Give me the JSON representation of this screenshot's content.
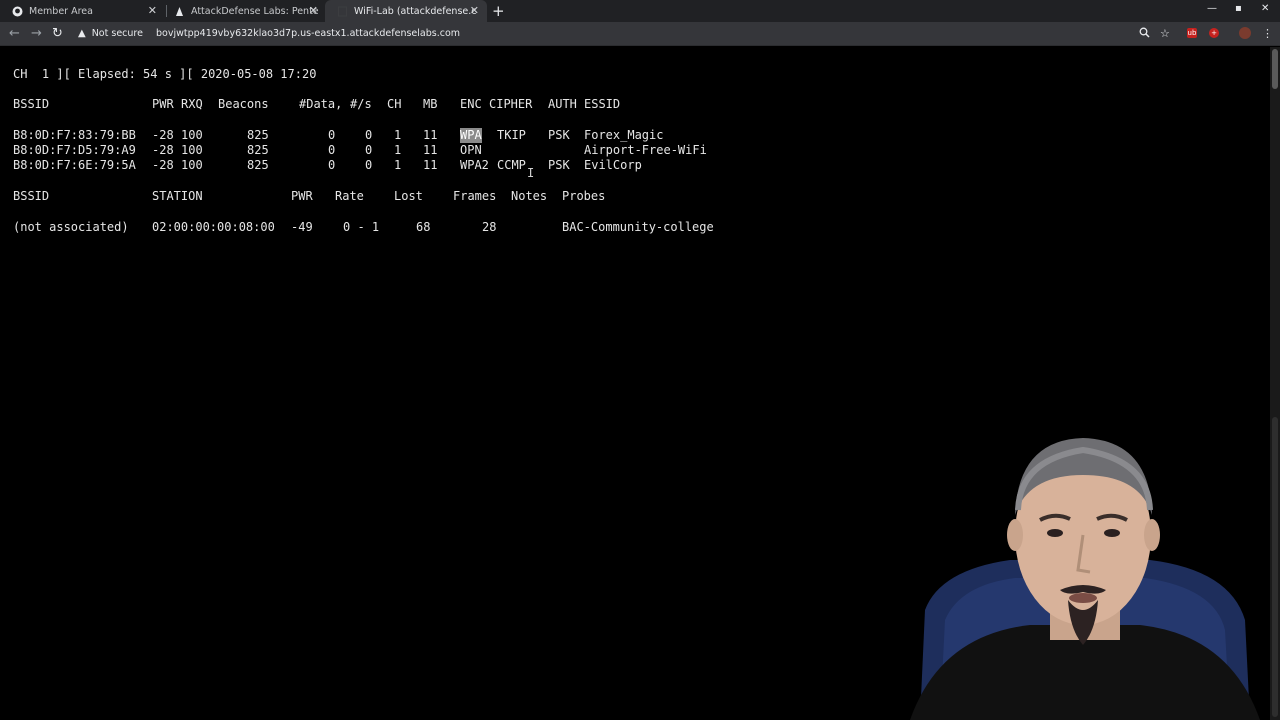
{
  "browser": {
    "tabs": [
      {
        "title": "Member Area",
        "icon": "github-icon"
      },
      {
        "title": "AttackDefense Labs: Pente",
        "icon": "attackdefense-icon"
      },
      {
        "title": "WiFi-Lab (attackdefense.c",
        "icon": "page-icon"
      }
    ],
    "security_label": "Not secure",
    "url": "bovjwtpp419vby632klao3d7p.us-eastx1.attackdefenselabs.com"
  },
  "terminal": {
    "status_line": "CH  1 ][ Elapsed: 54 s ][ 2020-05-08 17:20",
    "ap_header": {
      "bssid": "BSSID",
      "pwr": "PWR",
      "rxq": "RXQ",
      "beacons": "Beacons",
      "data": "#Data,",
      "rate": "#/s",
      "ch": "CH",
      "mb": "MB",
      "enc": "ENC",
      "cipher": "CIPHER",
      "auth": "AUTH",
      "essid": "ESSID"
    },
    "access_points": [
      {
        "bssid": "B8:0D:F7:83:79:BB",
        "pwr": "-28",
        "rxq": "100",
        "beacons": "825",
        "data": "0",
        "rate": "0",
        "ch": "1",
        "mb": "11",
        "enc": "WPA",
        "cipher": "TKIP",
        "auth": "PSK",
        "essid": "Forex_Magic"
      },
      {
        "bssid": "B8:0D:F7:D5:79:A9",
        "pwr": "-28",
        "rxq": "100",
        "beacons": "825",
        "data": "0",
        "rate": "0",
        "ch": "1",
        "mb": "11",
        "enc": "OPN",
        "cipher": "",
        "auth": "",
        "essid": "Airport-Free-WiFi"
      },
      {
        "bssid": "B8:0D:F7:6E:79:5A",
        "pwr": "-28",
        "rxq": "100",
        "beacons": "825",
        "data": "0",
        "rate": "0",
        "ch": "1",
        "mb": "11",
        "enc": "WPA2",
        "cipher": "CCMP",
        "auth": "PSK",
        "essid": "EvilCorp"
      }
    ],
    "station_header": {
      "bssid": "BSSID",
      "station": "STATION",
      "pwr": "PWR",
      "rate": "Rate",
      "lost": "Lost",
      "frames": "Frames",
      "notes": "Notes",
      "probes": "Probes"
    },
    "stations": [
      {
        "bssid": "(not associated)",
        "station": "02:00:00:00:08:00",
        "pwr": "-49",
        "rate": "0 - 1",
        "lost": "68",
        "frames": "28",
        "notes": "",
        "probes": "BAC-Community-college"
      }
    ]
  }
}
